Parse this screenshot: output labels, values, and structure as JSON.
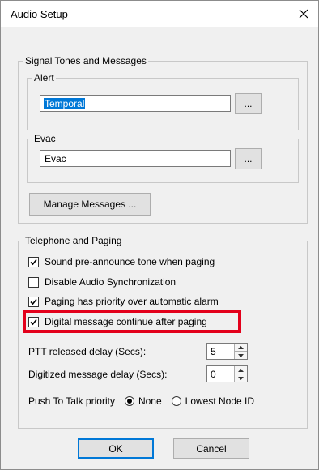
{
  "window": {
    "title": "Audio Setup"
  },
  "signal_group": {
    "legend": "Signal Tones and Messages",
    "alert": {
      "legend": "Alert",
      "value": "Temporal",
      "browse_label": "..."
    },
    "evac": {
      "legend": "Evac",
      "value": "Evac",
      "browse_label": "..."
    },
    "manage_messages_label": "Manage Messages ..."
  },
  "telephone_group": {
    "legend": "Telephone and Paging",
    "options": [
      {
        "label": "Sound pre-announce tone when paging",
        "checked": true
      },
      {
        "label": "Disable Audio Synchronization",
        "checked": false
      },
      {
        "label": "Paging has priority over automatic alarm",
        "checked": true
      },
      {
        "label": "Digital message continue after paging",
        "checked": true
      }
    ],
    "ptt_delay": {
      "label": "PTT released delay (Secs):",
      "value": "5"
    },
    "digitized_delay": {
      "label": "Digitized message delay (Secs):",
      "value": "0"
    },
    "push_to_talk": {
      "label": "Push To Talk priority",
      "options": [
        {
          "label": "None",
          "selected": true
        },
        {
          "label": "Lowest Node ID",
          "selected": false
        }
      ]
    }
  },
  "buttons": {
    "ok": "OK",
    "cancel": "Cancel"
  },
  "colors": {
    "highlight": "#e3001b",
    "selection": "#0078d7"
  }
}
